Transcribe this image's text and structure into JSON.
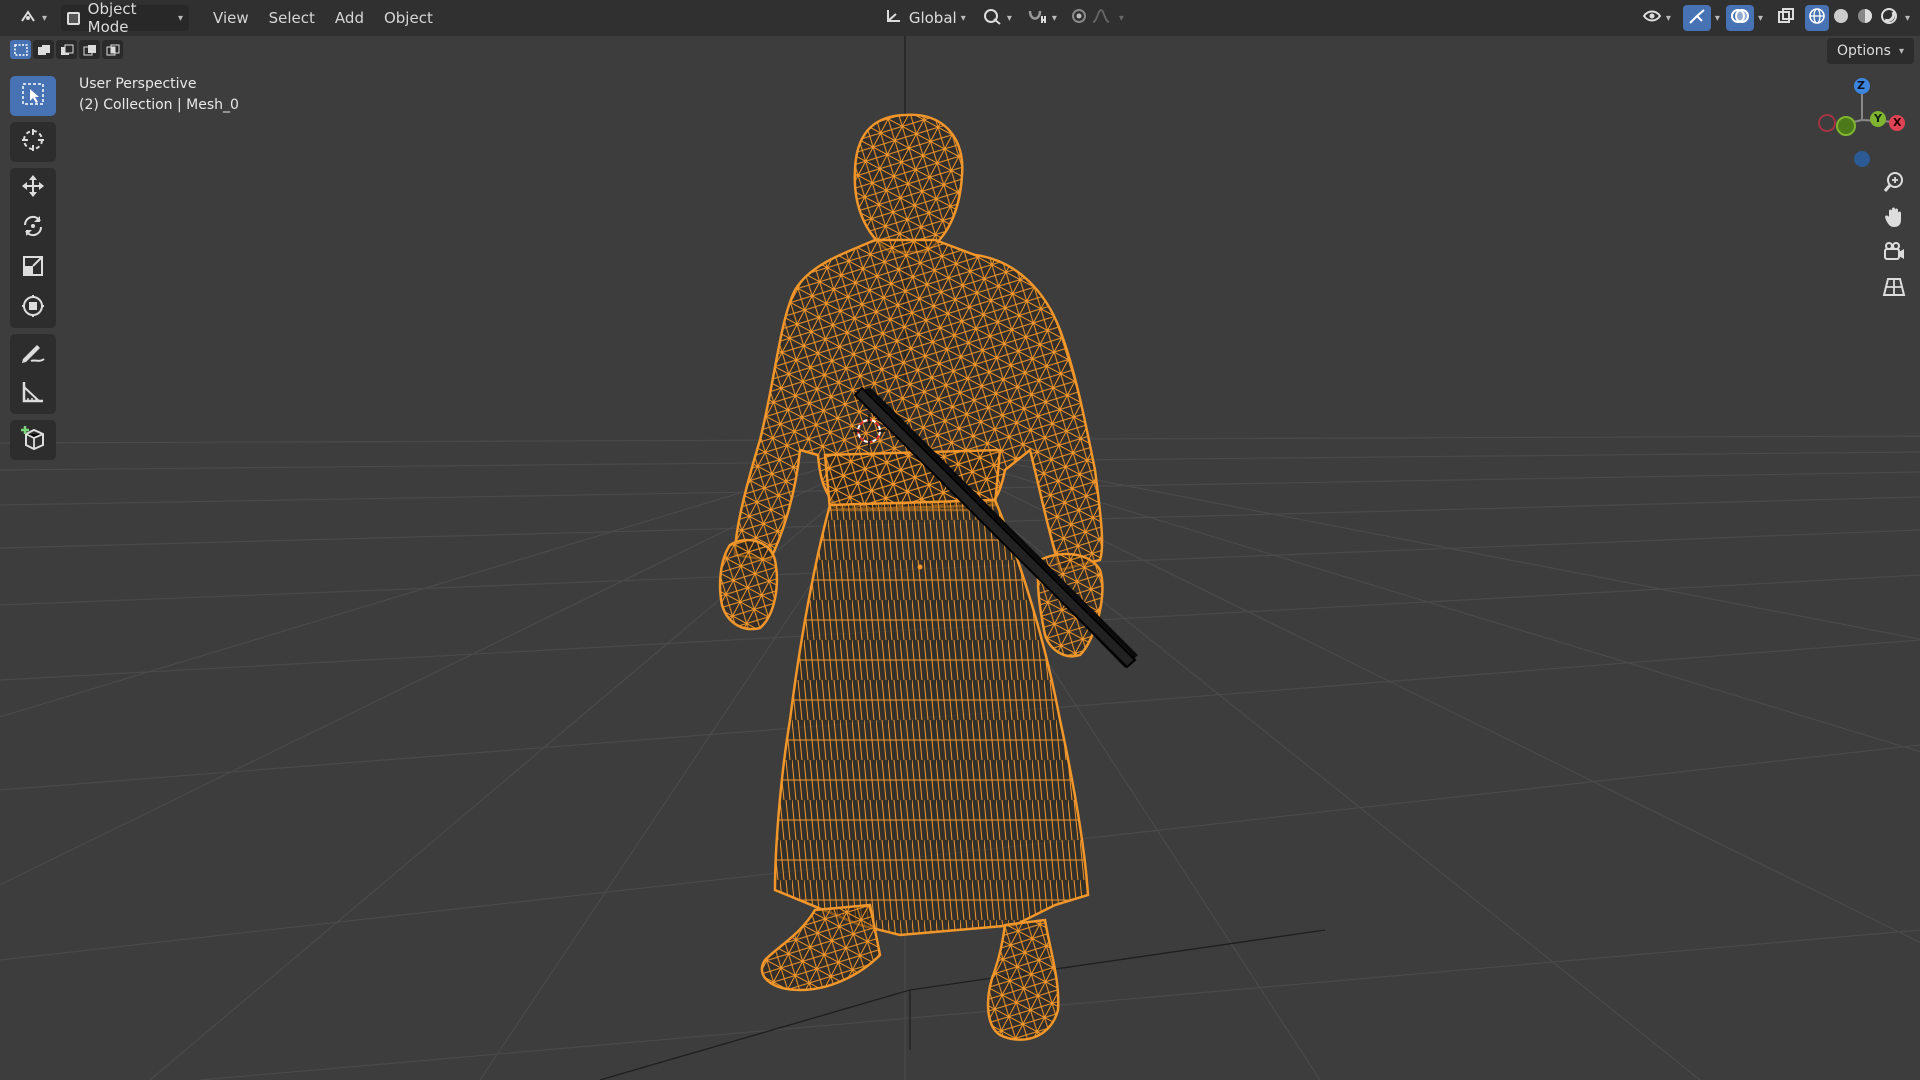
{
  "header": {
    "mode_label": "Object Mode",
    "menus": [
      "View",
      "Select",
      "Add",
      "Object"
    ],
    "orientation_label": "Global"
  },
  "options_label": "Options",
  "overlay": {
    "line1": "User Perspective",
    "line2": "(2) Collection | Mesh_0"
  },
  "gizmo": {
    "z": "Z",
    "y": "Y",
    "x": "X"
  },
  "colors": {
    "accent": "#4772b3",
    "selection_orange": "#f0962a",
    "viewport_bg": "#3d3d3d",
    "axis_x": "#e04454",
    "axis_y": "#7fb530",
    "axis_z": "#3c86e0"
  },
  "icons": [
    "editor-type-icon",
    "object-mode-icon",
    "transform-orientation-icon",
    "pivot-icon",
    "snap-icon",
    "proportional-edit-icon",
    "visibility-icon",
    "gizmo-icon",
    "overlay-icon",
    "xray-icon",
    "shading-wireframe-icon",
    "shading-solid-icon",
    "shading-material-icon",
    "shading-rendered-icon",
    "select-box-icon",
    "cursor-icon",
    "move-icon",
    "rotate-icon",
    "scale-icon",
    "transform-icon",
    "annotate-icon",
    "measure-icon",
    "add-cube-icon",
    "zoom-icon",
    "pan-hand-icon",
    "camera-icon",
    "grid-ortho-icon"
  ]
}
